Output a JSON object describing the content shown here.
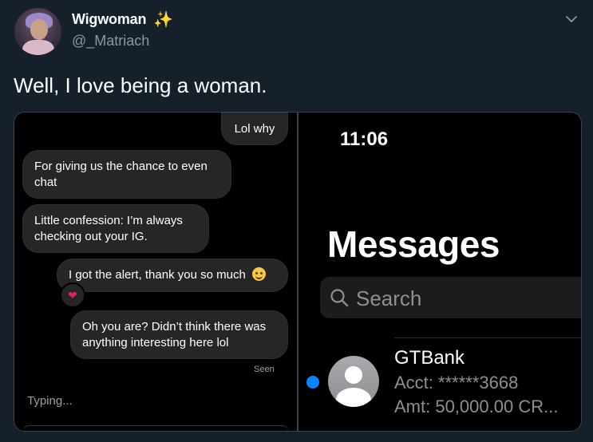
{
  "tweet": {
    "display_name": "Wigwoman",
    "display_name_emoji": "✨",
    "handle": "@_Matriach",
    "text": "Well, I love being a woman.",
    "menu_icon": "chevron-down-icon"
  },
  "chat": {
    "messages": [
      {
        "text": "Lol why",
        "from": "other"
      },
      {
        "text": "For giving us the chance to even chat",
        "from": "other"
      },
      {
        "text": "Little confession:  I’m always checking out your IG.",
        "from": "other"
      },
      {
        "text": "I got the alert, thank you so much",
        "from": "other",
        "emoji": "smiling-face",
        "reaction": "❤"
      },
      {
        "text": "Oh you are? Didn’t think there was anything interesting here lol",
        "from": "other"
      }
    ],
    "seen_label": "Seen",
    "typing_label": "Typing..."
  },
  "ios": {
    "time": "11:06",
    "title": "Messages",
    "search_placeholder": "Search",
    "conversation": {
      "name": "GTBank",
      "line1": "Acct: ******3668",
      "line2": "Amt: 50,000.00 CR...",
      "unread": true
    }
  },
  "colors": {
    "background": "#15202b",
    "secondary_text": "#8899a6",
    "unread_dot": "#0a84ff",
    "bubble": "#262626"
  }
}
